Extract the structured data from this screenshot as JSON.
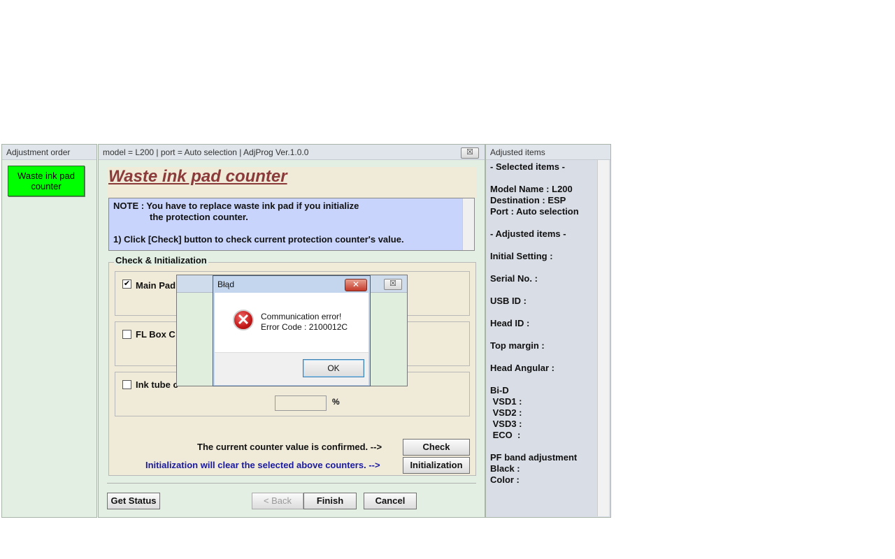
{
  "left_panel": {
    "title": "Adjustment order",
    "item_label_line1": "Waste ink pad",
    "item_label_line2": "counter"
  },
  "main_panel": {
    "title_bar": "model = L200 | port = Auto selection | AdjProg Ver.1.0.0",
    "close_glyph": "☒",
    "page_title": "Waste ink pad counter",
    "note": {
      "line1": "NOTE : You have to replace waste ink pad if you initialize",
      "line2": "the protection counter.",
      "line3": "1) Click [Check] button to check current protection counter's value."
    },
    "group_title": "Check & Initialization",
    "checkboxes": [
      {
        "label": "Main Pad",
        "checked": true,
        "mark": "✔"
      },
      {
        "label": "FL Box C",
        "checked": false,
        "mark": ""
      },
      {
        "label": "Ink tube c",
        "checked": false,
        "mark": ""
      }
    ],
    "percent_symbol": "%",
    "confirm_text": "The current counter value is confirmed. -->",
    "check_label": "Check",
    "init_text": "Initialization will clear the selected above counters. -->",
    "init_label": "Initialization",
    "get_status_label": "Get Status",
    "back_label": "< Back",
    "finish_label": "Finish",
    "cancel_label": "Cancel"
  },
  "right_panel": {
    "title": "Adjusted items",
    "lines": [
      "- Selected items -",
      "Model Name : L200",
      "Destination : ESP",
      "Port : Auto selection",
      "- Adjusted items -",
      "Initial Setting :",
      "Serial No. :",
      "USB ID :",
      "Head ID :",
      "Top margin :",
      "Head Angular :",
      "Bi-D",
      " VSD1 :",
      " VSD2 :",
      " VSD3 :",
      " ECO  :",
      "PF band adjustment",
      "Black :",
      "Color :"
    ]
  },
  "background_dialog": {
    "close_glyph": "☒"
  },
  "error_dialog": {
    "title": "Błąd",
    "close_glyph": "✕",
    "icon": "error-x-icon",
    "icon_glyph": "✕",
    "message_line1": "Communication error!",
    "message_line2": "Error Code : 2100012C",
    "ok_label": "OK"
  },
  "colors": {
    "accent_green": "#00ff00",
    "title_red": "#8b3a3a",
    "note_blue": "#c8d4fb",
    "init_text_blue": "#1a1aa0"
  }
}
